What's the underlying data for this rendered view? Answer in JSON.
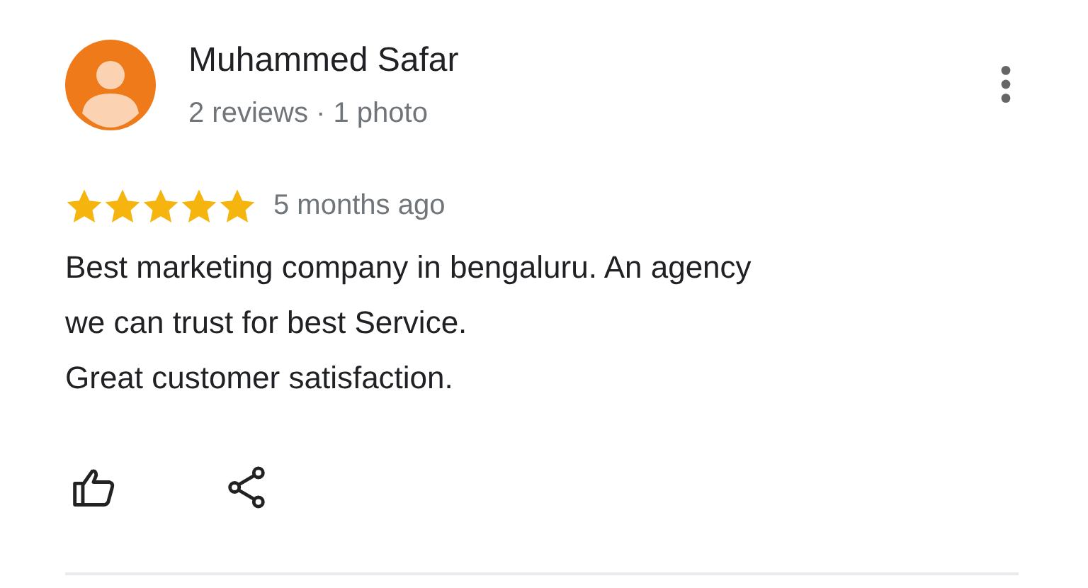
{
  "review": {
    "author": "Muhammed Safar",
    "meta": "2 reviews · 1 photo",
    "stars": 5,
    "time": "5 months ago",
    "text": "Best marketing company in bengaluru. An agency\nwe can trust for best Service.\nGreat customer satisfaction."
  }
}
